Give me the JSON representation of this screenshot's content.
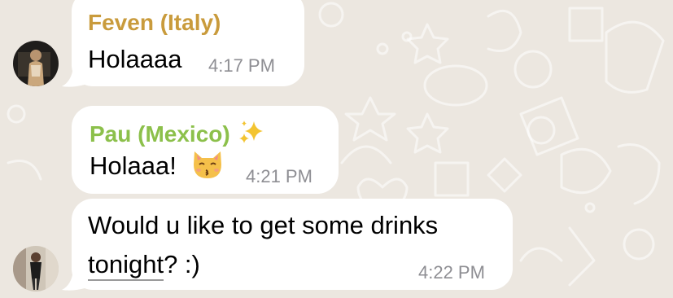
{
  "colors": {
    "background": "#ece7e0",
    "bubble": "#ffffff",
    "sender_1": "#c99b3c",
    "sender_2": "#8cc04b",
    "timestamp": "#8e8e93"
  },
  "messages": [
    {
      "sender": "Feven (Italy)",
      "text": "Holaaaa",
      "time": "4:17 PM"
    },
    {
      "sender": "Pau (Mexico)",
      "sender_emoji": "sparkles-icon",
      "text": "Holaaa!",
      "text_emoji": "kissing-cat-icon",
      "time": "4:21 PM"
    },
    {
      "text_line_1": "Would u like to get some drinks",
      "text_line_2_link": "tonight",
      "text_line_2_rest": "? :)",
      "time": "4:22 PM"
    }
  ]
}
